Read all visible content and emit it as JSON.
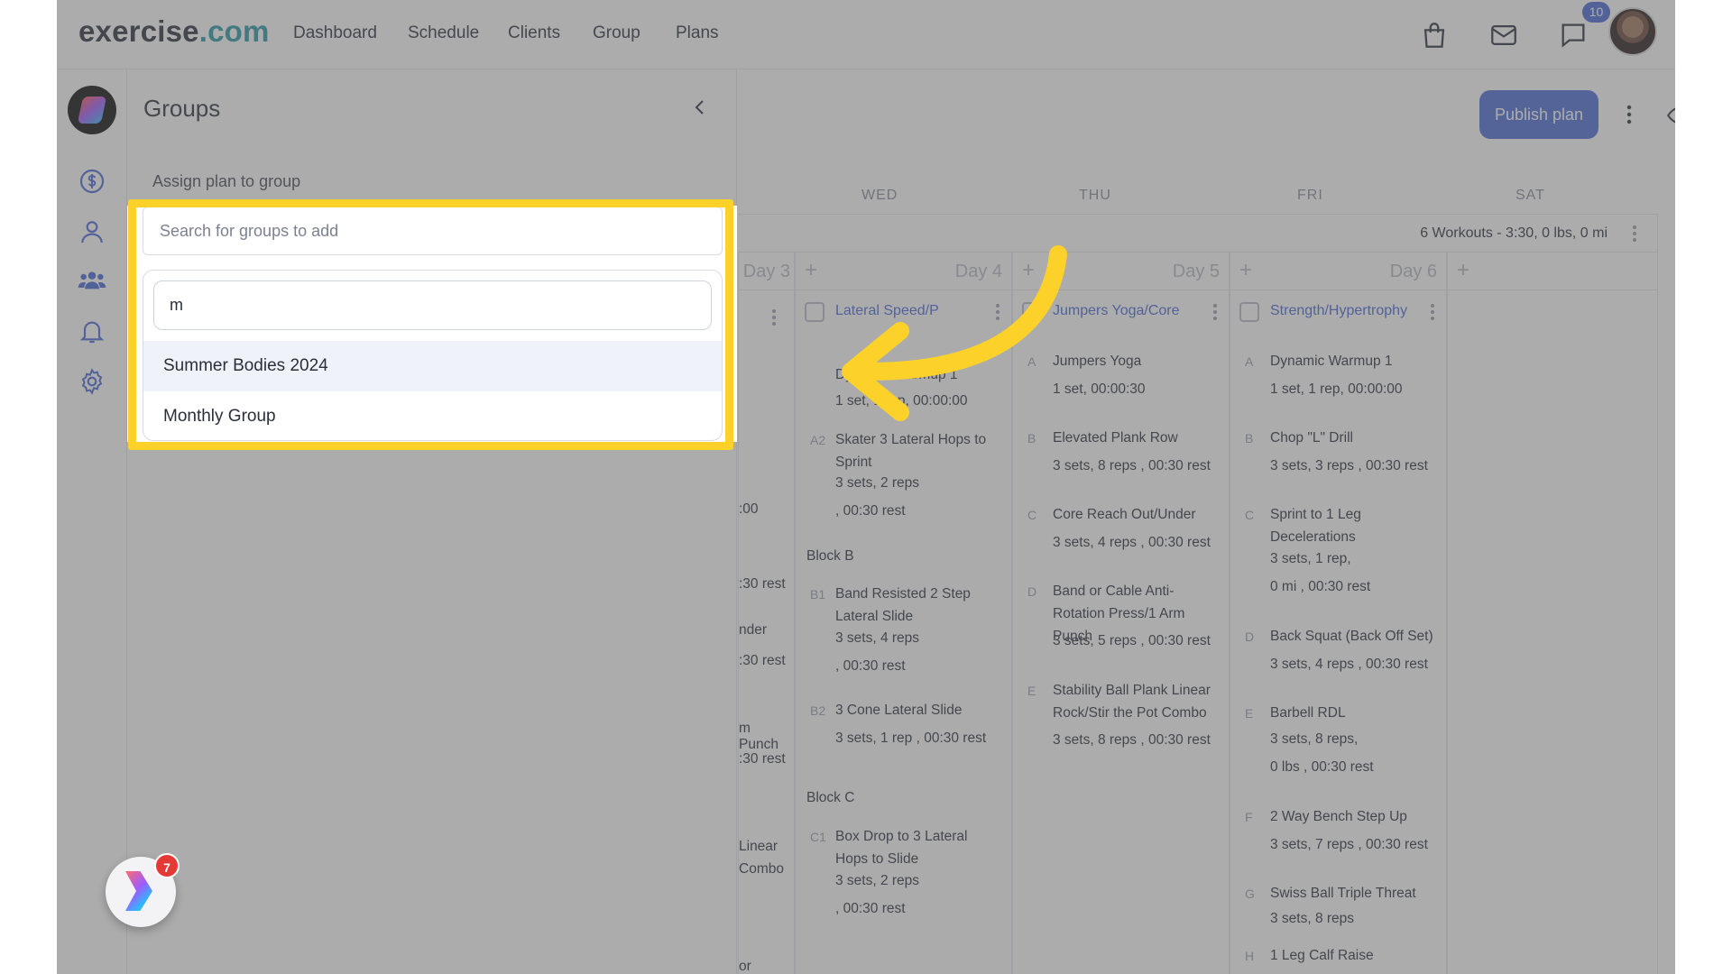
{
  "brand": {
    "name_part1": "exercise",
    "name_part2": ".com"
  },
  "nav": {
    "links": [
      "Dashboard",
      "Schedule",
      "Clients",
      "Group",
      "Plans"
    ],
    "notification_count": "10"
  },
  "rail": {
    "float_badge": "7"
  },
  "groups_panel": {
    "title": "Groups",
    "assign_label": "Assign plan to group",
    "search_placeholder": "Search for groups to add",
    "dropdown_query": "m",
    "options": [
      "Summer Bodies 2024",
      "Monthly Group"
    ]
  },
  "toolbar": {
    "publish_label": "Publish plan"
  },
  "day_headers": [
    "WED",
    "THU",
    "FRI",
    "SAT"
  ],
  "summary": "6 Workouts - 3:30, 0 lbs, 0 mi",
  "columns": [
    {
      "day_label": "Day 3",
      "partial_lines": [
        ":00",
        ":30 rest",
        "nder",
        ":30 rest",
        "m Punch",
        ":30 rest",
        "Linear",
        "Combo",
        "or"
      ]
    },
    {
      "day_label": "Day 4",
      "workout_title": "Lateral Speed/P",
      "exercises": [
        {
          "letter": "",
          "name": "Dynamic Warmup 1",
          "detail": "1 set, 1 rep, 00:00:00"
        },
        {
          "letter": "A2",
          "name": "Skater 3 Lateral Hops to Sprint",
          "detail": "3 sets, 2 reps",
          "detail2": ", 00:30 rest"
        },
        {
          "letter": "B1",
          "name": "Band Resisted 2 Step Lateral Slide",
          "detail": "3 sets, 4 reps",
          "detail2": ", 00:30 rest"
        },
        {
          "letter": "B2",
          "name": "3 Cone Lateral Slide",
          "detail": "3 sets, 1 rep , 00:30 rest"
        },
        {
          "letter": "C1",
          "name": "Box Drop to 3 Lateral Hops to Slide",
          "detail": "3 sets, 2 reps",
          "detail2": ", 00:30 rest"
        }
      ],
      "blocks": [
        "Block B",
        "Block C"
      ]
    },
    {
      "day_label": "Day 5",
      "workout_title": "Jumpers Yoga/Core",
      "exercises": [
        {
          "letter": "A",
          "name": "Jumpers Yoga",
          "detail": "1 set, 00:00:30"
        },
        {
          "letter": "B",
          "name": "Elevated Plank Row",
          "detail": "3 sets, 8 reps , 00:30 rest"
        },
        {
          "letter": "C",
          "name": "Core Reach Out/Under",
          "detail": "3 sets, 4 reps , 00:30 rest"
        },
        {
          "letter": "D",
          "name": "Band or Cable Anti-Rotation Press/1 Arm Punch",
          "detail": "3 sets, 5 reps , 00:30 rest"
        },
        {
          "letter": "E",
          "name": "Stability Ball Plank Linear Rock/Stir the Pot Combo",
          "detail": "3 sets, 8 reps , 00:30 rest"
        }
      ]
    },
    {
      "day_label": "Day 6",
      "workout_title": "Strength/Hypertrophy",
      "exercises": [
        {
          "letter": "A",
          "name": "Dynamic Warmup 1",
          "detail": "1 set, 1 rep, 00:00:00"
        },
        {
          "letter": "B",
          "name": "Chop \"L\" Drill",
          "detail": "3 sets, 3 reps , 00:30 rest"
        },
        {
          "letter": "C",
          "name": "Sprint to 1 Leg Decelerations",
          "detail": "3 sets, 1 rep,",
          "detail2": "0 mi , 00:30 rest"
        },
        {
          "letter": "D",
          "name": "Back Squat (Back Off Set)",
          "detail": "3 sets, 4 reps , 00:30 rest"
        },
        {
          "letter": "E",
          "name": "Barbell RDL",
          "detail": "3 sets, 8 reps,",
          "detail2": "0 lbs , 00:30 rest"
        },
        {
          "letter": "F",
          "name": "2 Way Bench Step Up",
          "detail": "3 sets, 7 reps , 00:30 rest"
        },
        {
          "letter": "G",
          "name": "Swiss Ball Triple Threat",
          "detail": "3 sets, 8 reps"
        },
        {
          "letter": "H",
          "name": "1 Leg Calf Raise",
          "detail": ""
        }
      ]
    }
  ],
  "colors": {
    "accent": "#4f6fd9",
    "highlight": "#fcd12a",
    "link": "#4b6bd8"
  }
}
